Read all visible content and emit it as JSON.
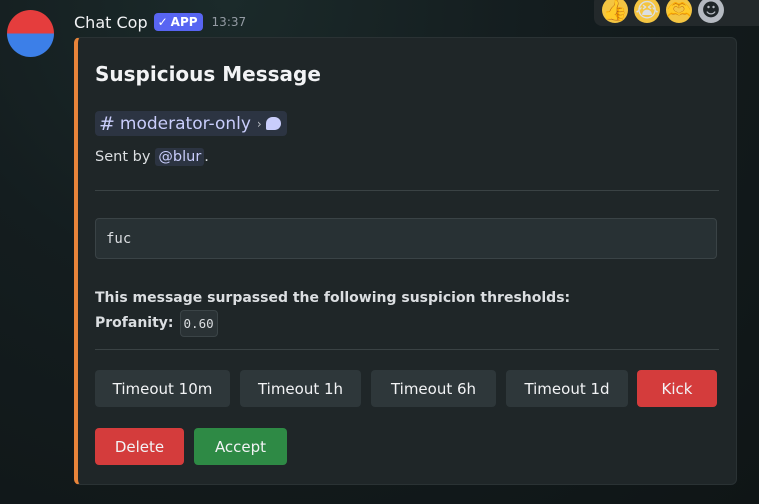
{
  "message": {
    "author": "Chat Cop",
    "badge": "APP",
    "badge_check": "✓",
    "timestamp": "13:37"
  },
  "reactions": [
    {
      "icon": "thumbs-up-icon",
      "glyph": "👍"
    },
    {
      "icon": "crying-face-icon",
      "glyph": "😭"
    },
    {
      "icon": "heart-hands-icon",
      "glyph": "🫶"
    },
    {
      "icon": "add-reaction-icon",
      "glyph": "☻"
    }
  ],
  "embed": {
    "accent_color": "#e8843a",
    "title": "Suspicious Message",
    "channel": {
      "hash": "#",
      "name": "moderator-only",
      "arrow": "›"
    },
    "sent_by_prefix": "Sent by",
    "sent_by_user": "@blur",
    "sent_by_suffix": ".",
    "message_content": "fuc",
    "threshold_heading": "This message surpassed the following suspicion thresholds:",
    "threshold_label": "Profanity:",
    "threshold_value": "0.60"
  },
  "buttons": {
    "timeout_10m": "Timeout 10m",
    "timeout_1h": "Timeout 1h",
    "timeout_6h": "Timeout 6h",
    "timeout_1d": "Timeout 1d",
    "kick": "Kick",
    "delete": "Delete",
    "accept": "Accept"
  },
  "colors": {
    "danger": "#d43c3c",
    "success": "#2e8a45",
    "secondary": "#2e373a",
    "brand": "#5865f2"
  }
}
